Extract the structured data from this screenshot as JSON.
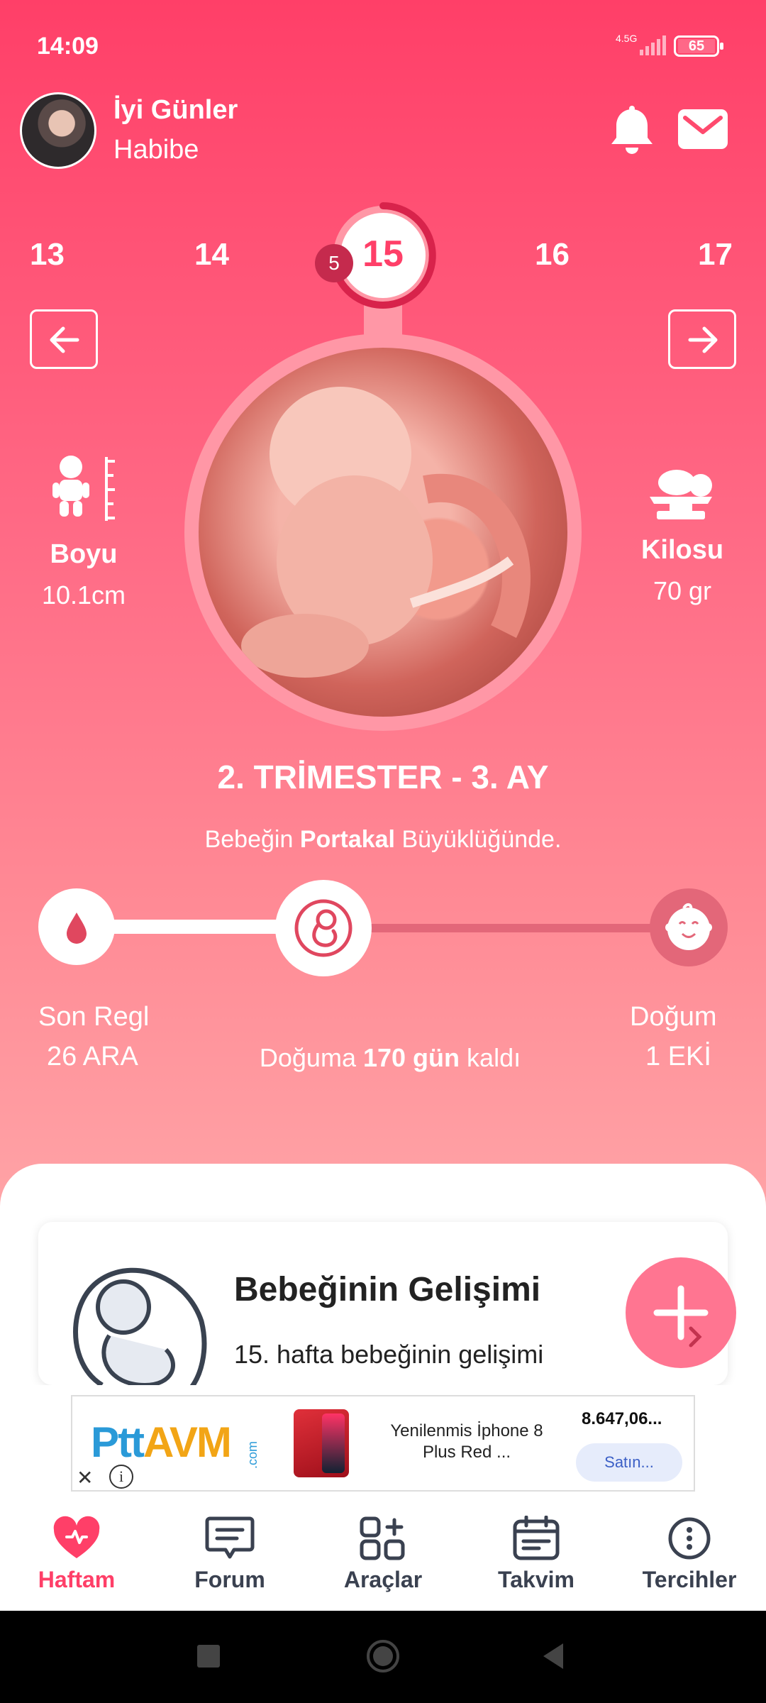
{
  "status": {
    "time": "14:09",
    "network": "4.5G",
    "battery": "65"
  },
  "header": {
    "greeting": "İyi Günler",
    "user_name": "Habibe"
  },
  "weeks": {
    "prev2": "13",
    "prev1": "14",
    "current": "15",
    "next1": "16",
    "next2": "17",
    "day_badge": "5"
  },
  "stats": {
    "length_label": "Boyu",
    "length_value": "10.1cm",
    "weight_label": "Kilosu",
    "weight_value": "70 gr"
  },
  "trimester": "2. TRİMESTER - 3. AY",
  "size": {
    "prefix": "Bebeğin",
    "fruit": "Portakal",
    "suffix": "Büyüklüğünde."
  },
  "timeline": {
    "start_label": "Son Regl",
    "start_date": "26 ARA",
    "end_label": "Doğum",
    "end_date": "1 EKİ",
    "countdown_prefix": "Doğuma",
    "countdown_days": "170 gün",
    "countdown_suffix": "kaldı",
    "progress_fraction": 0.4
  },
  "card": {
    "title": "Bebeğinin Gelişimi",
    "desc": "15. hafta bebeğinin gelişimi"
  },
  "ad": {
    "brand_ptt": "Ptt",
    "brand_avm": "AVM",
    "brand_com": ".com",
    "product": "Yenilenmis İphone 8 Plus Red ...",
    "price": "8.647,06...",
    "buy_label": "Satın...",
    "close": "✕",
    "info": "i"
  },
  "tabs": [
    {
      "label": "Haftam",
      "icon": "heart-icon",
      "active": true
    },
    {
      "label": "Forum",
      "icon": "chat-icon",
      "active": false
    },
    {
      "label": "Araçlar",
      "icon": "grid-plus-icon",
      "active": false
    },
    {
      "label": "Takvim",
      "icon": "calendar-icon",
      "active": false
    },
    {
      "label": "Tercihler",
      "icon": "more-icon",
      "active": false
    }
  ],
  "colors": {
    "primary": "#ff3f68",
    "accent_light": "#ff97a6",
    "fab": "#ff7591",
    "tab_text": "#3a4150"
  }
}
